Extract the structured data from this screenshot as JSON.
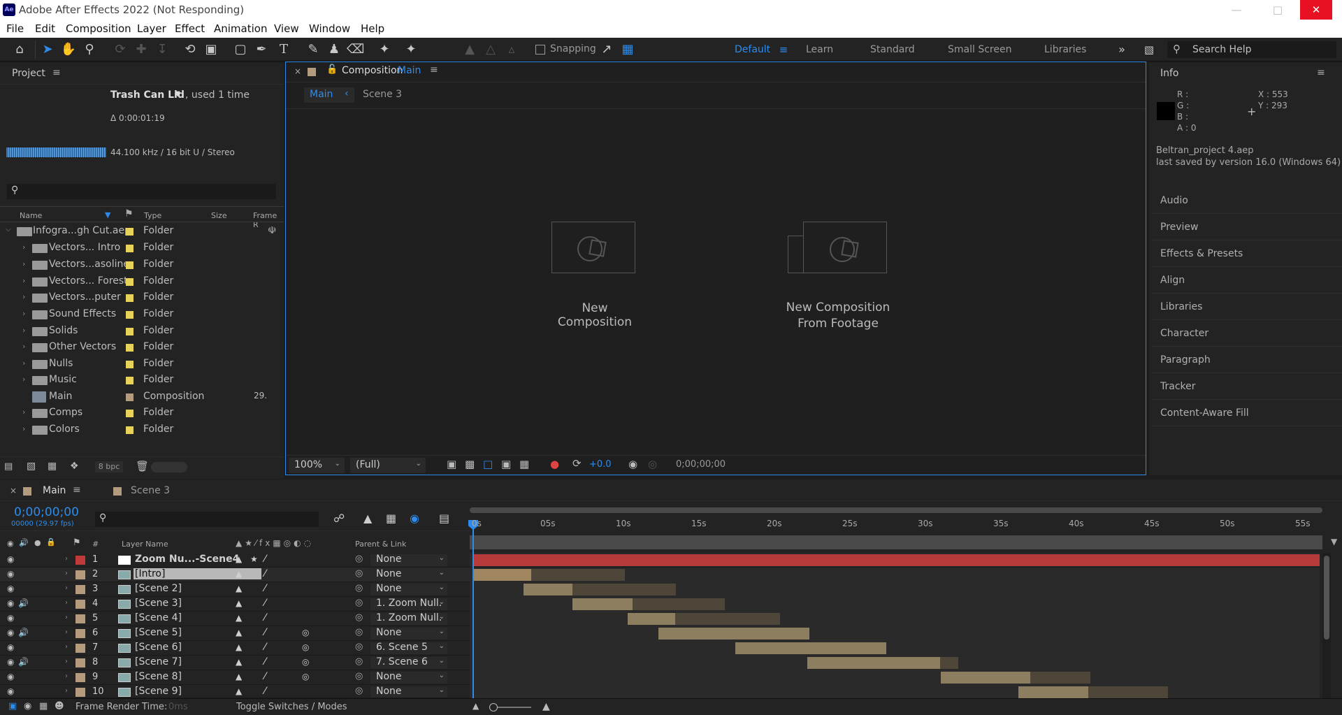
{
  "app": {
    "title": "Adobe After Effects 2022 (Not Responding)",
    "logo": "Ae"
  },
  "menu": [
    "File",
    "Edit",
    "Composition",
    "Layer",
    "Effect",
    "Animation",
    "View",
    "Window",
    "Help"
  ],
  "toolbar": {
    "snapping_label": "Snapping"
  },
  "workspaces": [
    "Default",
    "Learn",
    "Standard",
    "Small Screen",
    "Libraries"
  ],
  "search_help_placeholder": "Search Help",
  "project": {
    "title": "Project",
    "selected_item": "Trash Can Lid",
    "used_text": ", used 1 time",
    "duration": "Δ 0:00:01:19",
    "audio_info": "44.100 kHz / 16 bit U / Stereo",
    "columns": [
      "Name",
      "Type",
      "Size",
      "Frame R"
    ],
    "root": {
      "name": "Infogra...gh Cut.aep",
      "type": "Folder"
    },
    "items": [
      {
        "name": "Vectors... Intro",
        "type": "Folder"
      },
      {
        "name": "Vectors...asoline",
        "type": "Folder"
      },
      {
        "name": "Vectors... Forest",
        "type": "Folder"
      },
      {
        "name": "Vectors...puter",
        "type": "Folder"
      },
      {
        "name": "Sound Effects",
        "type": "Folder"
      },
      {
        "name": "Solids",
        "type": "Folder"
      },
      {
        "name": "Other Vectors",
        "type": "Folder"
      },
      {
        "name": "Nulls",
        "type": "Folder"
      },
      {
        "name": "Music",
        "type": "Folder"
      },
      {
        "name": "Main",
        "type": "Composition",
        "frame_rate": "29."
      },
      {
        "name": "Comps",
        "type": "Folder"
      },
      {
        "name": "Colors",
        "type": "Folder"
      }
    ],
    "bpc": "8 bpc"
  },
  "composition": {
    "tab_label": "Composition",
    "tab_name": "Main",
    "breadcrumbs": [
      "Main",
      "Scene 3"
    ],
    "new_comp": "New Composition",
    "new_comp_footage_1": "New Composition",
    "new_comp_footage_2": "From Footage",
    "zoom": "100%",
    "resolution": "(Full)",
    "exposure": "+0.0",
    "timecode": "0;00;00;00"
  },
  "info": {
    "title": "Info",
    "r": "R :",
    "g": "G :",
    "b": "B :",
    "a": "A :  0",
    "x": "X : 553",
    "y": "Y : 293",
    "project_file": "Beltran_project 4.aep",
    "saved_version": "last saved by version 16.0 (Windows 64)"
  },
  "side_panels": [
    "Audio",
    "Preview",
    "Effects & Presets",
    "Align",
    "Libraries",
    "Character",
    "Paragraph",
    "Tracker",
    "Content-Aware Fill"
  ],
  "timeline": {
    "tabs": [
      "Main",
      "Scene 3"
    ],
    "timecode": "0;00;00;00",
    "fps": "00000 (29.97 fps)",
    "columns": {
      "num": "#",
      "layer_name": "Layer Name",
      "parent": "Parent & Link"
    },
    "ruler": [
      "0s",
      "05s",
      "10s",
      "15s",
      "20s",
      "25s",
      "30s",
      "35s",
      "40s",
      "45s",
      "50s",
      "55s"
    ],
    "layers": [
      {
        "num": "1",
        "name": "Zoom Nu...-Scene4",
        "parent": "None",
        "label": "#c03a3a",
        "audio": false
      },
      {
        "num": "2",
        "name": "[Intro]",
        "parent": "None",
        "label": "#b49b7d",
        "audio": false
      },
      {
        "num": "3",
        "name": "[Scene 2]",
        "parent": "None",
        "label": "#b49b7d",
        "audio": false
      },
      {
        "num": "4",
        "name": "[Scene 3]",
        "parent": "1. Zoom Null.",
        "label": "#b49b7d",
        "audio": true
      },
      {
        "num": "5",
        "name": "[Scene 4]",
        "parent": "1. Zoom Null.",
        "label": "#b49b7d",
        "audio": false
      },
      {
        "num": "6",
        "name": "[Scene 5]",
        "parent": "None",
        "label": "#b49b7d",
        "audio": true
      },
      {
        "num": "7",
        "name": "[Scene 6]",
        "parent": "6. Scene 5",
        "label": "#b49b7d",
        "audio": false
      },
      {
        "num": "8",
        "name": "[Scene 7]",
        "parent": "7. Scene 6",
        "label": "#b49b7d",
        "audio": true
      },
      {
        "num": "9",
        "name": "[Scene 8]",
        "parent": "None",
        "label": "#b49b7d",
        "audio": false
      },
      {
        "num": "10",
        "name": "[Scene 9]",
        "parent": "None",
        "label": "#b49b7d",
        "audio": false
      }
    ],
    "frame_render_label": "Frame Render Time:",
    "frame_render_value": "0ms",
    "toggle_label": "Toggle Switches / Modes"
  },
  "colors": {
    "accent": "#2d8ceb",
    "layer_red": "#b73a3a",
    "clip_tan": "#8c7e5f"
  }
}
